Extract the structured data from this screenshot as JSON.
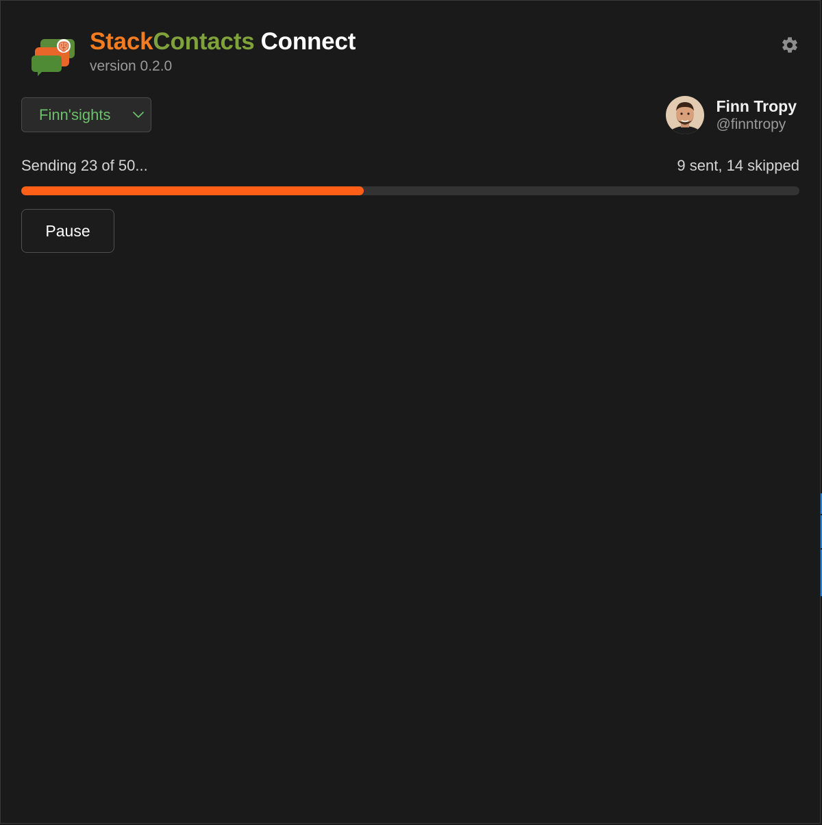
{
  "app": {
    "title_part1": "Stack",
    "title_part2": "Contacts",
    "title_part3": "Connect",
    "version": "version 0.2.0",
    "icons": {
      "logo": "chat-bubbles-brain-logo",
      "settings": "gear-icon"
    },
    "colors": {
      "brand_orange": "#f47c20",
      "brand_green": "#7fa23a",
      "progress": "#ff5f16",
      "workspace_label": "#6cc06c"
    }
  },
  "workspace": {
    "selected": "Finn'sights"
  },
  "user": {
    "name": "Finn Tropy",
    "handle": "@finntropy"
  },
  "progress": {
    "status": "Sending 23 of 50...",
    "summary": "9 sent, 14 skipped",
    "fraction": 0.44
  },
  "actions": {
    "pause_label": "Pause"
  }
}
